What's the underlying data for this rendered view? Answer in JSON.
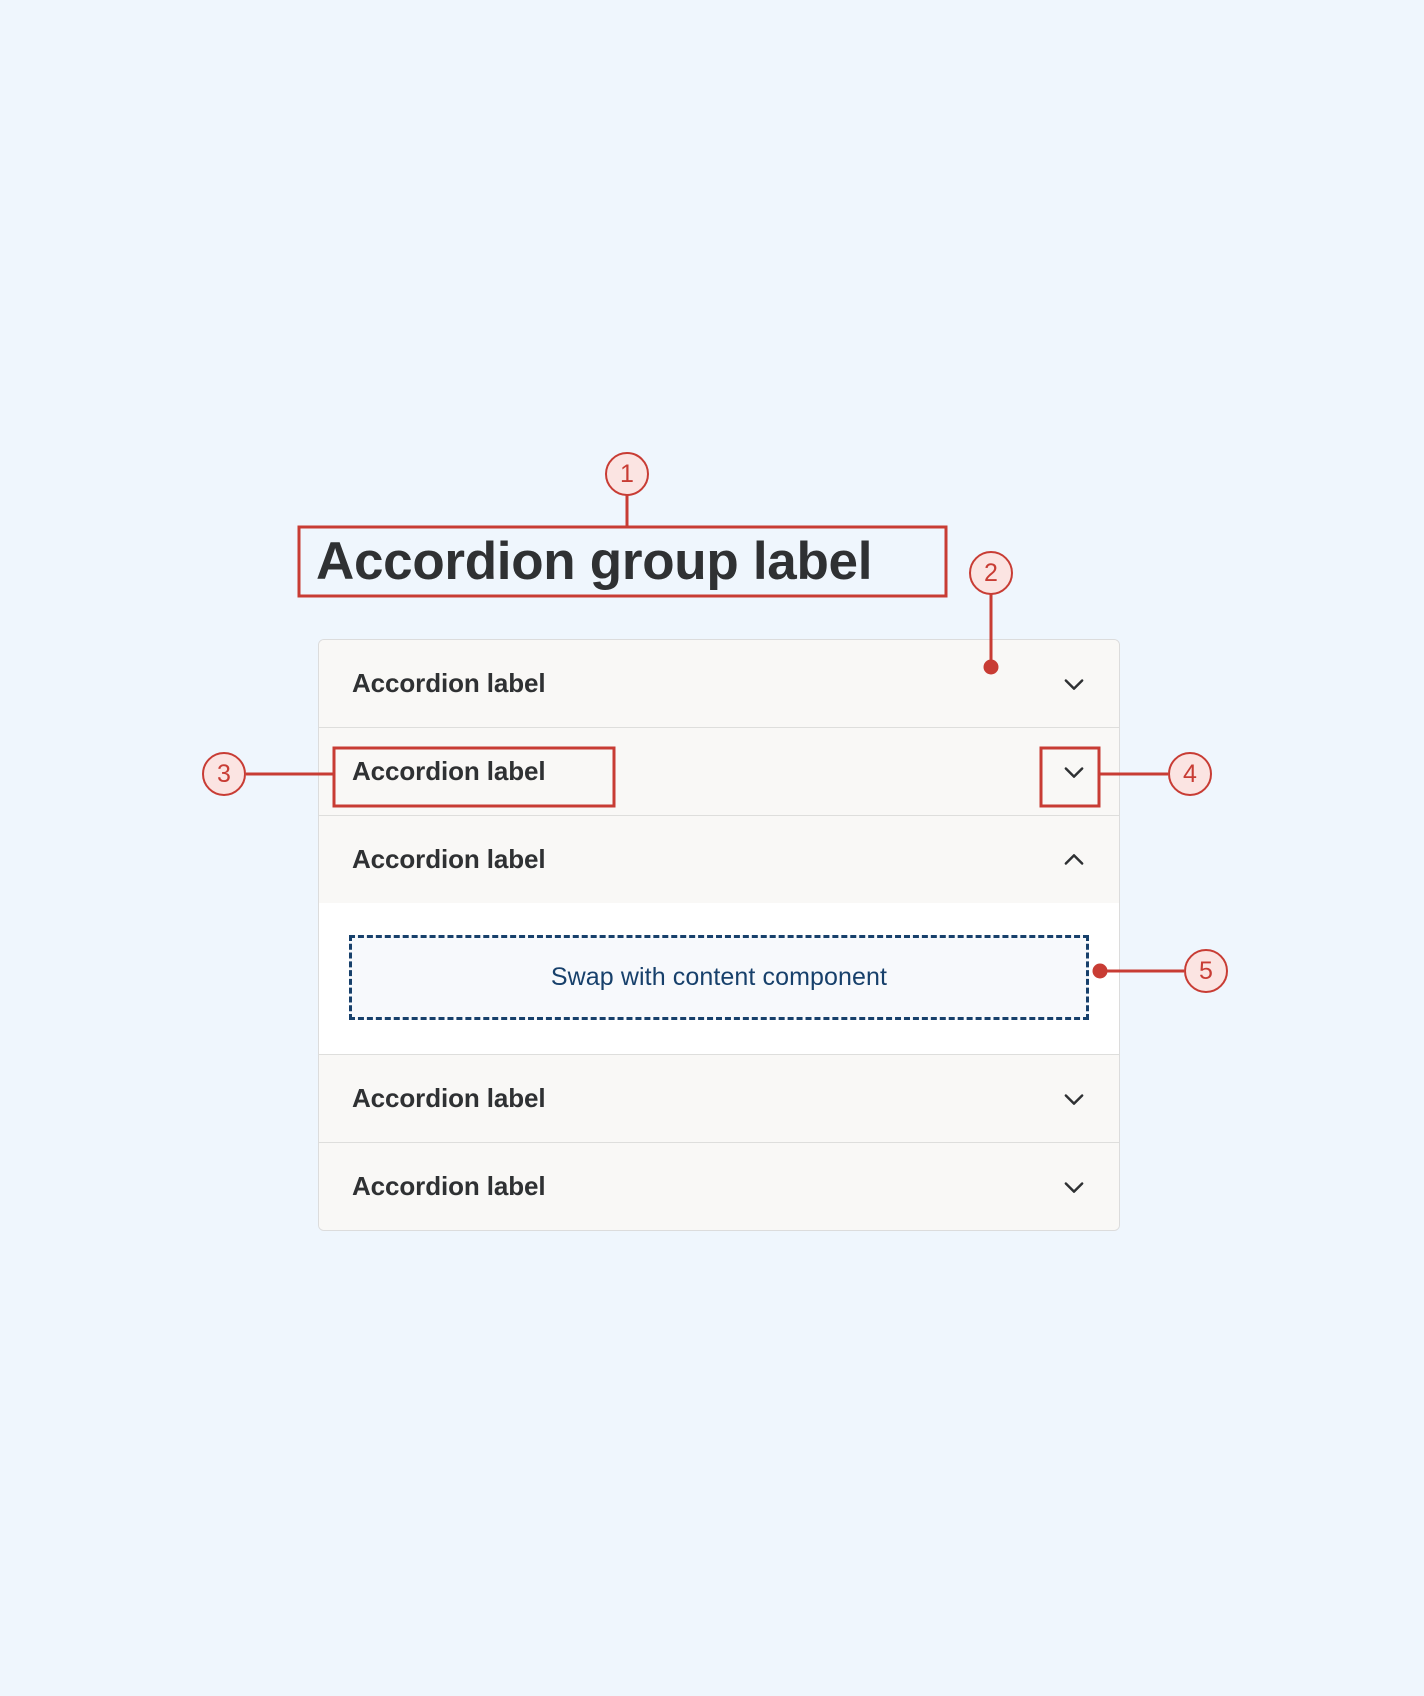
{
  "page": {
    "background_color": "#eff6fd",
    "accent_color": "#c83c34",
    "panel_background": "#f9f8f6",
    "label_color": "#2f3133",
    "swap_color": "#17406b"
  },
  "group": {
    "title": "Accordion group label"
  },
  "accordion": {
    "items": [
      {
        "label": "Accordion label",
        "expanded": false,
        "icon": "chevron-down-icon"
      },
      {
        "label": "Accordion label",
        "expanded": false,
        "icon": "chevron-down-icon"
      },
      {
        "label": "Accordion label",
        "expanded": true,
        "icon": "chevron-up-icon"
      },
      {
        "label": "Accordion label",
        "expanded": false,
        "icon": "chevron-down-icon"
      },
      {
        "label": "Accordion label",
        "expanded": false,
        "icon": "chevron-down-icon"
      }
    ],
    "content_placeholder": "Swap with content component"
  },
  "annotations": [
    {
      "number": "1",
      "target": "accordion-group-label"
    },
    {
      "number": "2",
      "target": "accordion-item-row"
    },
    {
      "number": "3",
      "target": "accordion-item-label"
    },
    {
      "number": "4",
      "target": "accordion-chevron-icon"
    },
    {
      "number": "5",
      "target": "accordion-content-area"
    }
  ]
}
